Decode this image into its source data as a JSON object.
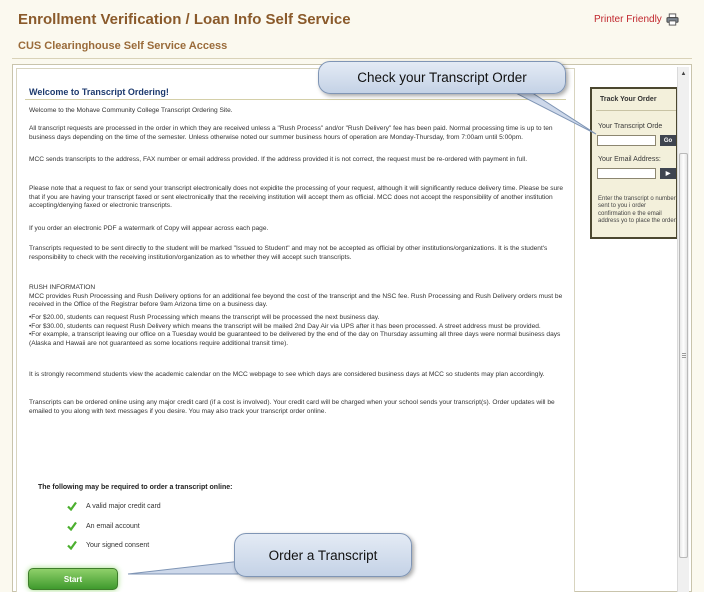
{
  "header": {
    "title": "Enrollment Verification / Loan Info Self Service",
    "subtitle": "CUS Clearinghouse Self Service Access",
    "printer_label": "Printer Friendly"
  },
  "main": {
    "welcome": "Welcome to Transcript Ordering!",
    "paragraphs": [
      "Welcome to the Mohave Community College Transcript Ordering Site.",
      "All transcript requests are processed in the order in which they are received unless a \"Rush Process\" and/or \"Rush Delivery\" fee has been paid. Normal processing time is up to ten business days depending on the time of the semester. Unless otherwise noted our summer business hours of operation are Monday-Thursday, from 7:00am until 5:00pm.",
      "MCC sends transcripts to the address, FAX number or email address provided. If the address provided it is not correct, the request must be re-ordered with payment in full.",
      "Please note that a request to fax or send your transcript electronically does not expidite the processing of your request, although it will significantly reduce delivery time. Please be sure that if you are having your transcript faxed or sent electronically that the receiving institution will accept them as official. MCC does not accept the responsibility of another institution accepting/denying faxed or electronic transcripts.",
      "If you order an electronic PDF a watermark of Copy will appear across each page.",
      "Transcripts requested to be sent directly to the student will be marked \"Issued to Student\" and may not be accepted as official by other institutions/organizations. It is the student's responsibility to check with the receiving institution/organization as to whether they will accept such transcripts.",
      "RUSH INFORMATION\nMCC provides Rush Processing and Rush Delivery options for an additional fee beyond the cost of the transcript and the NSC fee. Rush Processing and Rush Delivery orders must be received in the Office of the Registrar before 9am Arizona time on a business day.",
      "•For $20.00, students can request Rush Processing which means the transcript will be processed the next business day.\n•For $30.00, students can request Rush Delivery which means the transcript will be mailed 2nd Day Air via UPS after it has been processed. A street address must be provided.\n•For example, a transcript leaving our office on a Tuesday would be guaranteed to be delivered by the end of the day on Thursday assuming all three days were normal business days (Alaska and Hawaii are not guaranteed as some locations require additional transit time).",
      "It is strongly recommend students view the academic calendar on the MCC webpage to see which days are considered business days at MCC so students may plan accordingly.",
      "Transcripts can be ordered online using any major credit card (if a cost is involved). Your credit card will be charged when your school sends your transcript(s). Order updates will be emailed to you along with text messages if you desire. You may also track your transcript order online."
    ],
    "requirements_heading": "The following may be required to order a transcript online:",
    "requirements": [
      "A valid major credit card",
      "An email account",
      "Your signed consent"
    ],
    "start_label": "Start"
  },
  "track": {
    "title": "Track Your Order",
    "order_label": "Your Transcript Orde",
    "order_value": "",
    "go_label": "Go",
    "email_label": "Your Email Address:",
    "email_value": "",
    "go2_label": "▶",
    "help": "Enter the transcript o number sent to you i order confirmation e the email address yo to place the order."
  },
  "callouts": {
    "check": "Check your Transcript Order",
    "order": "Order a Transcript"
  },
  "scrollbar": {
    "up_arrow": "▲"
  },
  "colors": {
    "title": "#8a5a2b",
    "printer": "#c0272d",
    "welcome": "#1d3a6e",
    "start": "#3f9a2d",
    "panel_border": "#4b472f"
  },
  "icons": {
    "printer": "printer-icon",
    "check": "check-icon"
  }
}
